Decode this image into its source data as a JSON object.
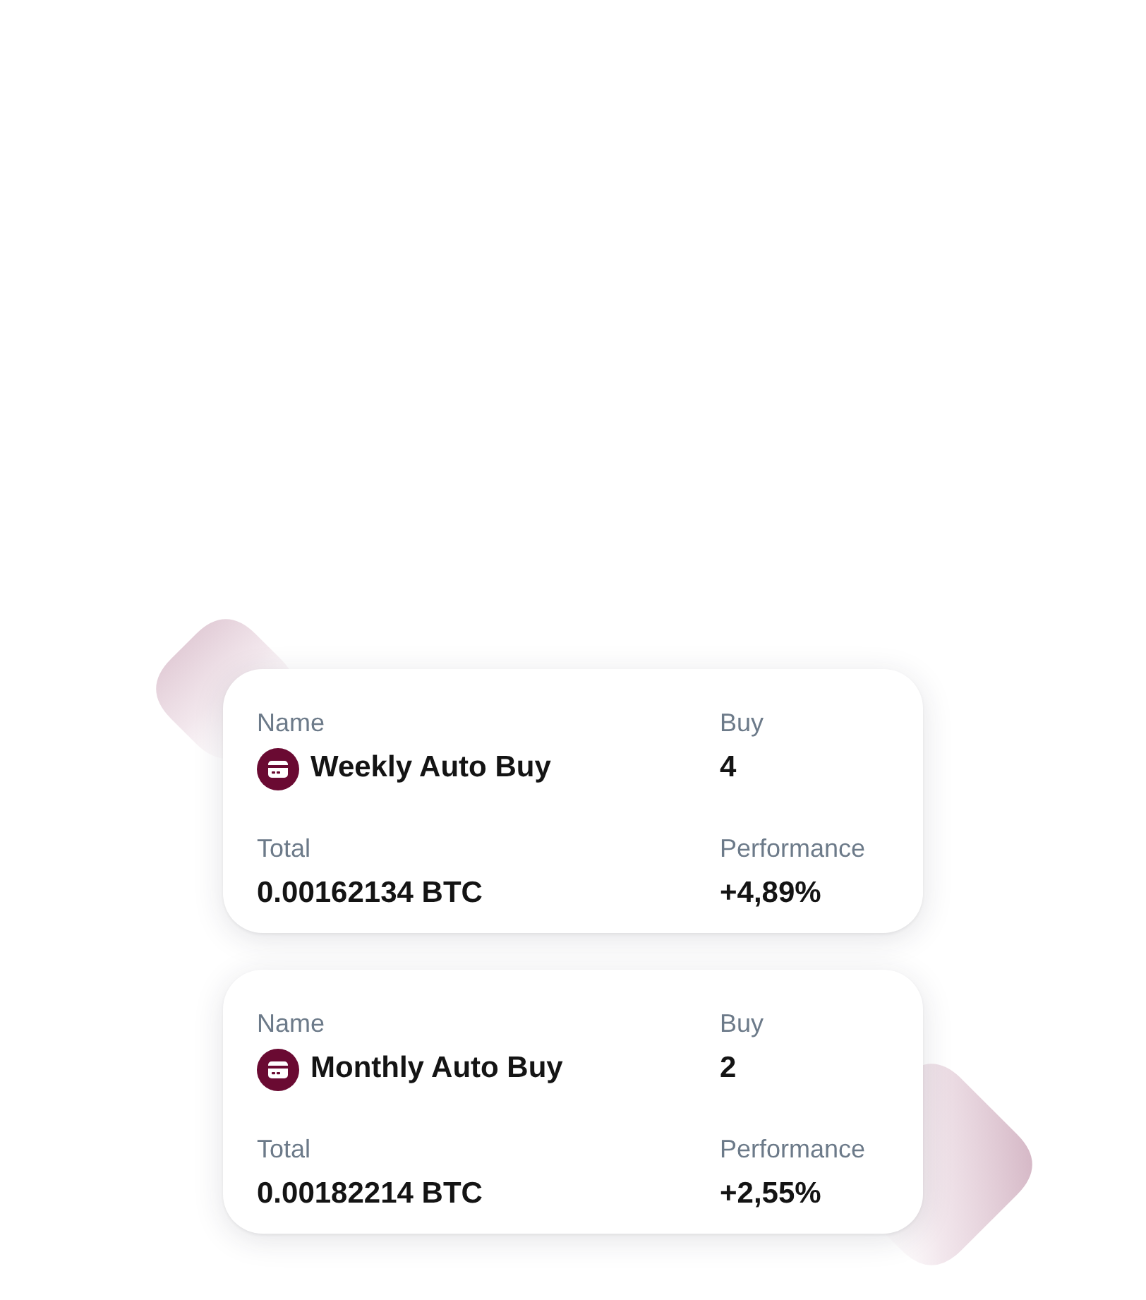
{
  "auto_buys": [
    {
      "name_label": "Name",
      "name": "Weekly Auto Buy",
      "buy_label": "Buy",
      "buy": "4",
      "total_label": "Total",
      "total": "0.00162134 BTC",
      "performance_label": "Performance",
      "performance": "+4,89%"
    },
    {
      "name_label": "Name",
      "name": "Monthly Auto Buy",
      "buy_label": "Buy",
      "buy": "2",
      "total_label": "Total",
      "total": "0.00182214 BTC",
      "performance_label": "Performance",
      "performance": "+2,55%"
    }
  ]
}
